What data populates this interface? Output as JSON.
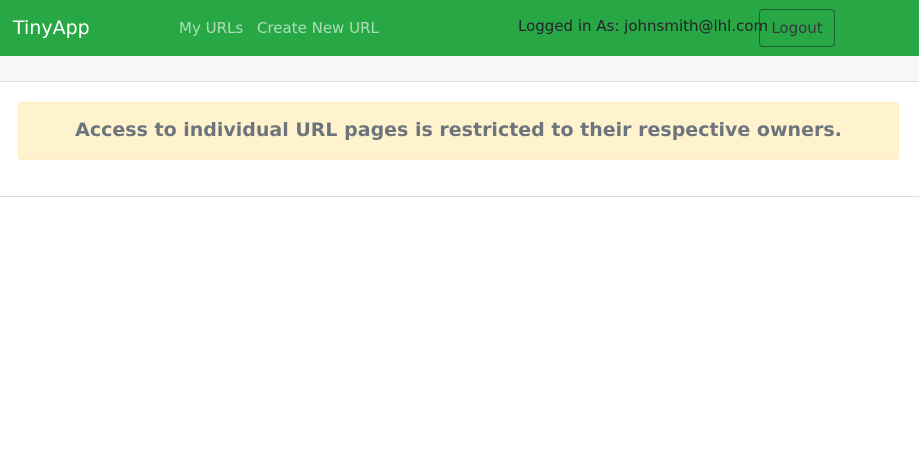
{
  "navbar": {
    "brand": "TinyApp",
    "links": [
      "My URLs",
      "Create New URL"
    ],
    "logged_in_text": "Logged in As: johnsmith@lhl.com",
    "logout_label": "Logout",
    "background_color": "#28a745"
  },
  "main": {
    "alert_text": "Access to individual URL pages is restricted to their respective owners.",
    "alert_background_color": "#fff3cd"
  }
}
